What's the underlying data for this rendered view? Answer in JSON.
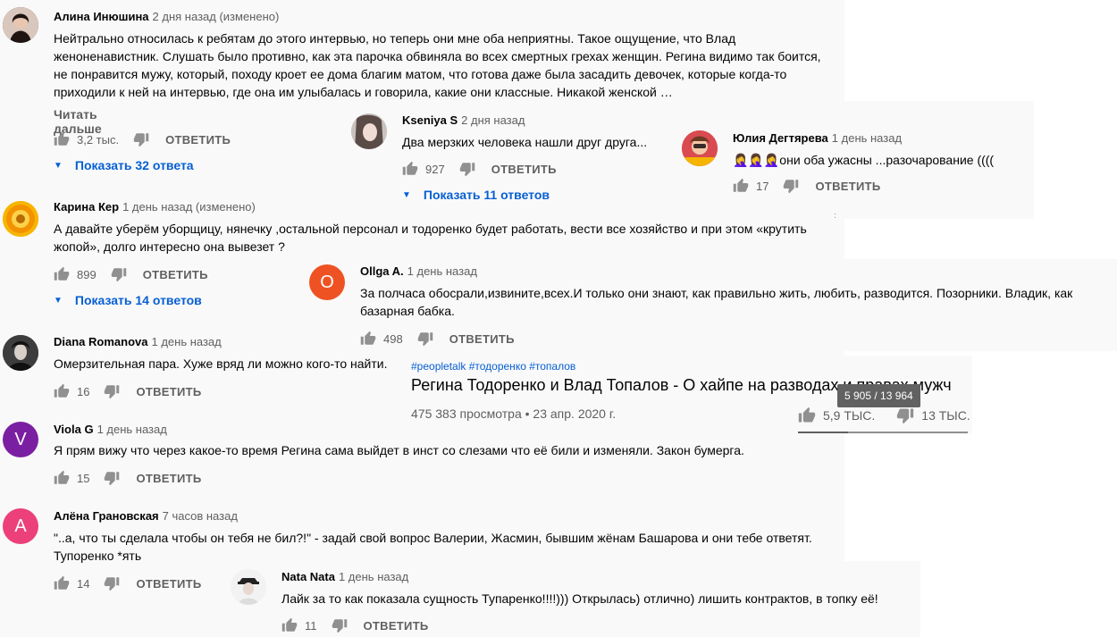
{
  "comments": {
    "c1": {
      "author": "Алина Инюшина",
      "time": "2 дня назад (изменено)",
      "text": "Нейтрально относилась к ребятам до этого интервью, но теперь они мне оба неприятны. Такое ощущение, что Влад женоненавистник. Слушать было противно, как эта парочка обвиняла во всех смертных грехах женщин. Регина видимо так боится, не понравится мужу, который, походу кроет ее дома благим матом, что готова даже была засадить девочек, которые когда-то приходили к ней на интервью, где она им улыбалась и говорила, какие они классные. Никакой женской …",
      "read_more": "Читать дальше",
      "likes": "3,2 тыс.",
      "reply": "ОТВЕТИТЬ",
      "replies": "Показать 32 ответа"
    },
    "c2": {
      "author": "Kseniya S",
      "time": "2 дня назад",
      "text": "Два мерзких человека нашли друг друга...",
      "likes": "927",
      "reply": "ОТВЕТИТЬ",
      "replies": "Показать 11 ответов"
    },
    "c3": {
      "author": "Юлия Дегтярева",
      "time": "1 день назад",
      "text": "🤦‍♀️🤦‍♀️🤦‍♀️они оба ужасны ...разочарование ((((",
      "likes": "17",
      "reply": "ОТВЕТИТЬ"
    },
    "c4": {
      "author": "Карина Кер",
      "time": "1 день назад (изменено)",
      "text": "А давайте уберём уборщицу, нянечку ,остальной персонал и тодоренко будет работать, вести все хозяйство и при этом «крутить жопой», долго интересно она вывезет ?",
      "likes": "899",
      "reply": "ОТВЕТИТЬ",
      "replies": "Показать 14 ответов"
    },
    "c5": {
      "author": "Ollga A.",
      "time": "1 день назад",
      "avatar_letter": "O",
      "text": "За полчаса обосрали,извините,всех.И только они знают, как правильно жить, любить, разводится. Позорники. Владик, как базарная бабка.",
      "likes": "498",
      "reply": "ОТВЕТИТЬ"
    },
    "c6": {
      "author": "Diana Romanova",
      "time": "1 день назад",
      "text": "Омерзительная пара. Хуже вряд ли можно кого-то найти.",
      "likes": "16",
      "reply": "ОТВЕТИТЬ"
    },
    "c7": {
      "author": "Viola G",
      "time": "1 день назад",
      "avatar_letter": "V",
      "text": "Я прям вижу что через какое-то время Регина сама выйдет в инст со слезами что её били и изменяли. Закон бумерга.",
      "likes": "15",
      "reply": "ОТВЕТИТЬ"
    },
    "c8": {
      "author": "Алёна Грановская",
      "time": "7 часов назад",
      "avatar_letter": "A",
      "text": "\"..а, что ты сделала чтобы он тебя не бил?!\" - задай свой вопрос Валерии, Жасмин, бывшим жёнам Башарова и они тебе ответят. Тупоренко *ять",
      "likes": "14",
      "reply": "ОТВЕТИТЬ"
    },
    "c9": {
      "author": "Nata Nata",
      "time": "1 день назад",
      "text": "Лайк за то как показала сущность Тупаренко!!!!))) Открылась) отлично) лишить контрактов, в топку её!",
      "likes": "11",
      "reply": "ОТВЕТИТЬ"
    }
  },
  "video": {
    "hashtags": "#peopletalk #тодоренко #топалов",
    "title": "Регина Тодоренко и Влад Топалов - О хайпе на разводах и правах мужч",
    "views": "475 383 просмотра • 23 апр. 2020 г.",
    "likes": "5,9 ТЫС.",
    "dislikes": "13 ТЫС.",
    "ratio_tooltip": "5 905 / 13 964",
    "like_fraction": 0.297
  },
  "colors": {
    "link": "#065fd4",
    "muted": "#606060",
    "ollga_avatar": "#ef5222",
    "viola_avatar": "#7b1fa2",
    "alena_avatar": "#ec407a"
  }
}
